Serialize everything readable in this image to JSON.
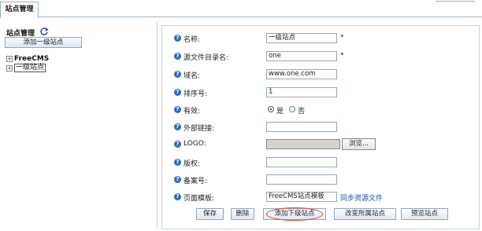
{
  "tabs": [
    {
      "label": "站点管理"
    }
  ],
  "left": {
    "title": "站点管理",
    "add_top_button": "添加一级站点",
    "tree": [
      {
        "label": "FreeCMS",
        "toggle": "+"
      },
      {
        "label": "一级站点",
        "toggle": "+"
      }
    ]
  },
  "form": {
    "name": {
      "label": "名称:",
      "value": "一级站点",
      "required": "*"
    },
    "source_dir": {
      "label": "源文件目录名:",
      "value": "one",
      "required": "*"
    },
    "domain": {
      "label": "域名:",
      "value": "www.one.com"
    },
    "order": {
      "label": "排序号:",
      "value": "1"
    },
    "valid": {
      "label": "有效:",
      "yes": "是",
      "no": "否"
    },
    "external_link": {
      "label": "外部链接:",
      "value": ""
    },
    "logo": {
      "label": "LOGO:",
      "browse": "浏览..."
    },
    "copyright": {
      "label": "版权:",
      "value": ""
    },
    "record_no": {
      "label": "备案号:",
      "value": ""
    },
    "template": {
      "label": "页面模板:",
      "value": "FreeCMS站点模板",
      "sync_link": "同步资源文件"
    }
  },
  "buttons": {
    "save": "保存",
    "delete": "删除",
    "add_child": "添加下级站点",
    "change_parent": "改变所属站点",
    "preview": "预览站点"
  },
  "colors": {
    "accent": "#2f6ebd",
    "highlight_circle": "#e23b3b",
    "link": "#1f4fa8"
  }
}
